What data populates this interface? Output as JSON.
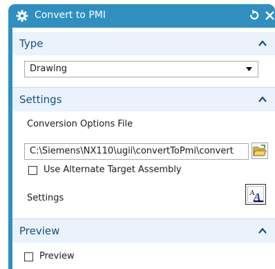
{
  "window": {
    "title": "Convert to PMI"
  },
  "icons": {
    "title": "gear-icon",
    "reset": "reset-icon",
    "close": "close-icon",
    "collapse": "chevron-up-icon",
    "dropdown": "chevron-down-icon",
    "browse": "open-folder-icon",
    "text_style": "text-style-icon"
  },
  "colors": {
    "titlebar": "#2f8fc1",
    "section_header": "#eaf3fb",
    "section_text": "#174e80"
  },
  "sections": {
    "type": {
      "label": "Type",
      "dropdown_value": "Drawing"
    },
    "settings": {
      "label": "Settings",
      "conversion_options_label": "Conversion Options File",
      "conversion_options_value": "C:\\Siemens\\NX110\\ugii\\convertToPmi\\convert",
      "alternate_assembly_label": "Use Alternate Target Assembly",
      "alternate_assembly_checked": false,
      "settings_label": "Settings"
    },
    "preview": {
      "label": "Preview",
      "preview_checkbox_label": "Preview",
      "preview_checked": false
    }
  }
}
